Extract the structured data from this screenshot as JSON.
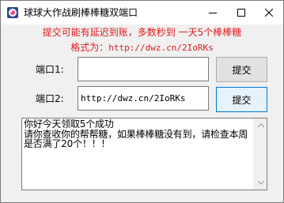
{
  "window": {
    "title": "球球大作战刷棒棒糖双端口",
    "controls": {
      "minimize": "minimize-icon",
      "maximize": "maximize-icon",
      "close": "close-icon"
    },
    "app_icon": "app-logo-icon"
  },
  "notice": {
    "line1": "提交可能有延迟到账，多数秒到 一天5个棒棒糖",
    "line2_prefix": "格式为：",
    "line2_value": "http://dwz.cn/2IoRKs",
    "color": "#e11b1b"
  },
  "ports": [
    {
      "label": "端口1:",
      "value": "",
      "button": "提交"
    },
    {
      "label": "端口2:",
      "value": "http://dwz.cn/2IoRKs",
      "button": "提交"
    }
  ],
  "log": {
    "text": "你好今天领取5个成功\n请你查收你的帮帮糖，如果棒棒糖没有到，请检查本周是否满了20个！！！"
  },
  "scrollbar": {
    "up": "scroll-up-arrow-icon",
    "down": "scroll-down-arrow-icon"
  }
}
